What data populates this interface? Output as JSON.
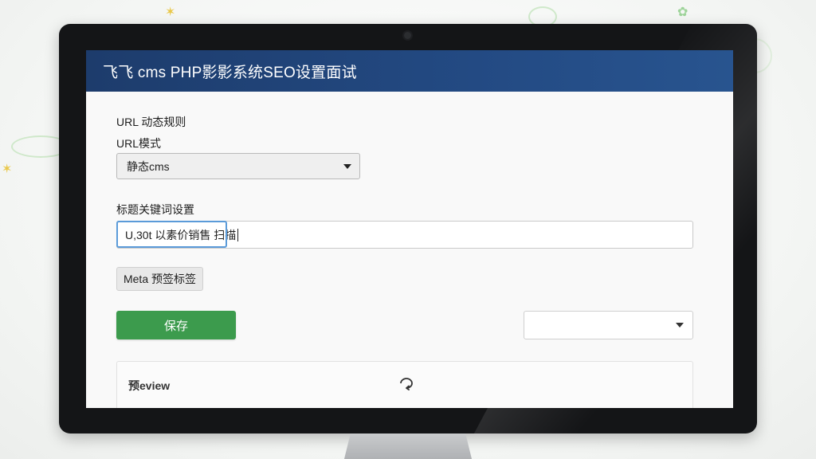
{
  "app": {
    "title": "飞飞 cms PHP影影系统SEO设置面试"
  },
  "url_section": {
    "heading": "URL 动态规则",
    "mode_label": "URL模式",
    "mode_select": {
      "value": "静态cms",
      "icon": "chevron-down-icon"
    }
  },
  "title_keywords": {
    "label": "标题关键词设置",
    "value": "U,30t 以素价销售 扫描"
  },
  "meta": {
    "button_label": "Meta 预签标签"
  },
  "actions": {
    "save_label": "保存",
    "save_color": "#3c9b4d",
    "secondary_select_value": ""
  },
  "preview": {
    "title": "预eview",
    "refresh_icon": "refresh-icon"
  },
  "colors": {
    "header_bg": "#1d3c6c",
    "accent_focus": "#5b9bd9"
  }
}
